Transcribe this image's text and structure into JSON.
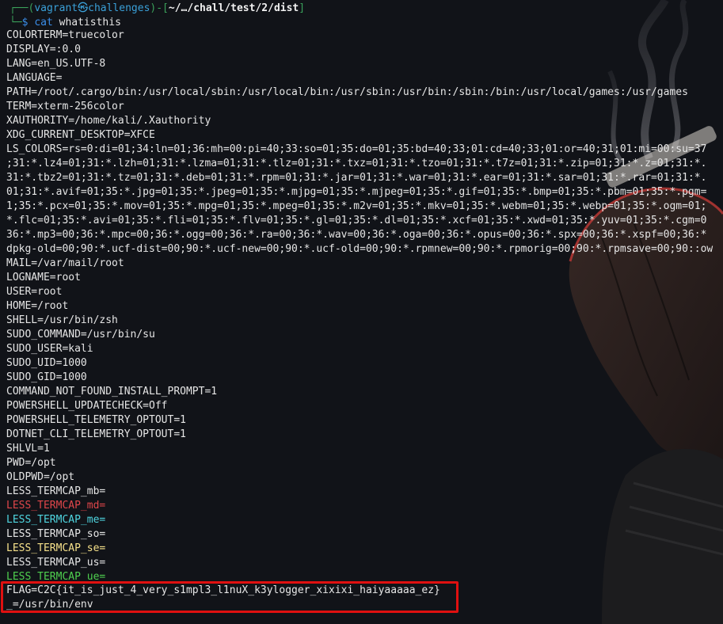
{
  "prompt": {
    "user": "vagrant",
    "at": "㉿",
    "host": "challenges",
    "path": "~/…/chall/test/2/dist",
    "dollar": "$",
    "command": "cat",
    "argument": "whatisthis"
  },
  "env_lines": [
    "COLORTERM=truecolor",
    "DISPLAY=:0.0",
    "LANG=en_US.UTF-8",
    "LANGUAGE=",
    "PATH=/root/.cargo/bin:/usr/local/sbin:/usr/local/bin:/usr/sbin:/usr/bin:/sbin:/bin:/usr/local/games:/usr/games",
    "TERM=xterm-256color",
    "XAUTHORITY=/home/kali/.Xauthority",
    "XDG_CURRENT_DESKTOP=XFCE",
    "LS_COLORS=rs=0:di=01;34:ln=01;36:mh=00:pi=40;33:so=01;35:do=01;35:bd=40;33;01:cd=40;33;01:or=40;31;01:mi=00:su=37",
    ";31:*.lz4=01;31:*.lzh=01;31:*.lzma=01;31:*.tlz=01;31:*.txz=01;31:*.tzo=01;31:*.t7z=01;31:*.zip=01;31:*.z=01;31:*.",
    "31:*.tbz2=01;31:*.tz=01;31:*.deb=01;31:*.rpm=01;31:*.jar=01;31:*.war=01;31:*.ear=01;31:*.sar=01;31:*.rar=01;31:*.",
    "01;31:*.avif=01;35:*.jpg=01;35:*.jpeg=01;35:*.mjpg=01;35:*.mjpeg=01;35:*.gif=01;35:*.bmp=01;35:*.pbm=01;35:*.pgm=",
    "1;35:*.pcx=01;35:*.mov=01;35:*.mpg=01;35:*.mpeg=01;35:*.m2v=01;35:*.mkv=01;35:*.webm=01;35:*.webp=01;35:*.ogm=01;",
    "*.flc=01;35:*.avi=01;35:*.fli=01;35:*.flv=01;35:*.gl=01;35:*.dl=01;35:*.xcf=01;35:*.xwd=01;35:*.yuv=01;35:*.cgm=0",
    "36:*.mp3=00;36:*.mpc=00;36:*.ogg=00;36:*.ra=00;36:*.wav=00;36:*.oga=00;36:*.opus=00;36:*.spx=00;36:*.xspf=00;36:*",
    "dpkg-old=00;90:*.ucf-dist=00;90:*.ucf-new=00;90:*.ucf-old=00;90:*.rpmnew=00;90:*.rpmorig=00;90:*.rpmsave=00;90::ow",
    "MAIL=/var/mail/root",
    "LOGNAME=root",
    "USER=root",
    "HOME=/root",
    "SHELL=/usr/bin/zsh",
    "SUDO_COMMAND=/usr/bin/su",
    "SUDO_USER=kali",
    "SUDO_UID=1000",
    "SUDO_GID=1000",
    "COMMAND_NOT_FOUND_INSTALL_PROMPT=1",
    "POWERSHELL_UPDATECHECK=Off",
    "POWERSHELL_TELEMETRY_OPTOUT=1",
    "DOTNET_CLI_TELEMETRY_OPTOUT=1",
    "SHLVL=1",
    "PWD=/opt",
    "OLDPWD=/opt",
    "LESS_TERMCAP_mb=",
    "LESS_TERMCAP_md=",
    "LESS_TERMCAP_me=",
    "LESS_TERMCAP_so=",
    "LESS_TERMCAP_se=",
    "LESS_TERMCAP_us=",
    "LESS_TERMCAP_ue="
  ],
  "flag_line": "FLAG=C2C{it_is_just_4_very_s1mpl3_l1nuX_k3ylogger_xixixi_haiyaaaaa_ez}",
  "last_line": "_=/usr/bin/env",
  "colors": {
    "background": "#111318",
    "text": "#e6e6e6",
    "prompt_blue": "#3b8eea",
    "prompt_green": "#3aa05a",
    "highlight_box": "#e01010",
    "termcap_md": "#e0464a",
    "termcap_me": "#4fd6e0",
    "termcap_se": "#f5e08a",
    "termcap_ue": "#4fd04f"
  }
}
